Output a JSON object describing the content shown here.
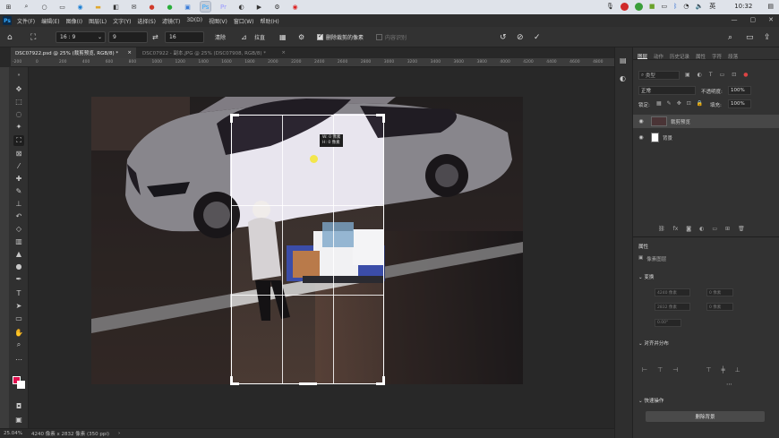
{
  "taskbar": {
    "clock": "10:32",
    "ime": "英"
  },
  "menubar": {
    "logo": "Ps",
    "items": [
      "文件(F)",
      "编辑(E)",
      "图像(I)",
      "图层(L)",
      "文字(Y)",
      "选择(S)",
      "滤镜(T)",
      "3D(D)",
      "视图(V)",
      "窗口(W)",
      "帮助(H)"
    ]
  },
  "options": {
    "ratio": "16 : 9",
    "width": "9",
    "height": "16",
    "clear": "清除",
    "straighten": "拉直",
    "delete_cropped": "删除裁剪的像素",
    "content_aware": "内容识别"
  },
  "tabs": [
    {
      "label": "DSC07922.psd @ 25% (裁剪预览, RGB/8) *"
    },
    {
      "label": "DSC07922 - 副本.JPG @ 25% (DSC07908, RGB/8) *"
    }
  ],
  "ruler_labels": [
    "-200",
    "0",
    "200",
    "400",
    "600",
    "800",
    "1000",
    "1200",
    "1400",
    "1600",
    "1800",
    "2000",
    "2200",
    "2400",
    "2600",
    "2800",
    "3000",
    "3200",
    "3400",
    "3600",
    "3800",
    "4000",
    "4200",
    "4400",
    "4600",
    "4800"
  ],
  "crop_tooltip": {
    "line1": "W: 0 像素",
    "line2": "H: 0 像素"
  },
  "status": {
    "zoom": "25.04%",
    "doc": "4240 像素 x 2832 像素 (350 ppi)"
  },
  "layers_panel": {
    "tabs": [
      "图层",
      "动作",
      "历史记录",
      "属性",
      "字符",
      "段落"
    ],
    "kind": "类型",
    "blend": "正常",
    "opacity_label": "不透明度:",
    "opacity": "100%",
    "lock_label": "锁定:",
    "fill_label": "填充:",
    "fill": "100%",
    "layers": [
      {
        "name": "裁剪预览",
        "selected": true
      },
      {
        "name": "背景",
        "selected": false
      }
    ]
  },
  "properties_panel": {
    "title": "属性",
    "doc_label": "像素图层",
    "transform": "变换",
    "w": "4240 像素",
    "h": "2832 像素",
    "x": "0 像素",
    "y": "0 像素",
    "angle": "0.00°",
    "align": "对齐并分布",
    "quick_actions": "快速操作",
    "remove_bg": "删除背景"
  }
}
